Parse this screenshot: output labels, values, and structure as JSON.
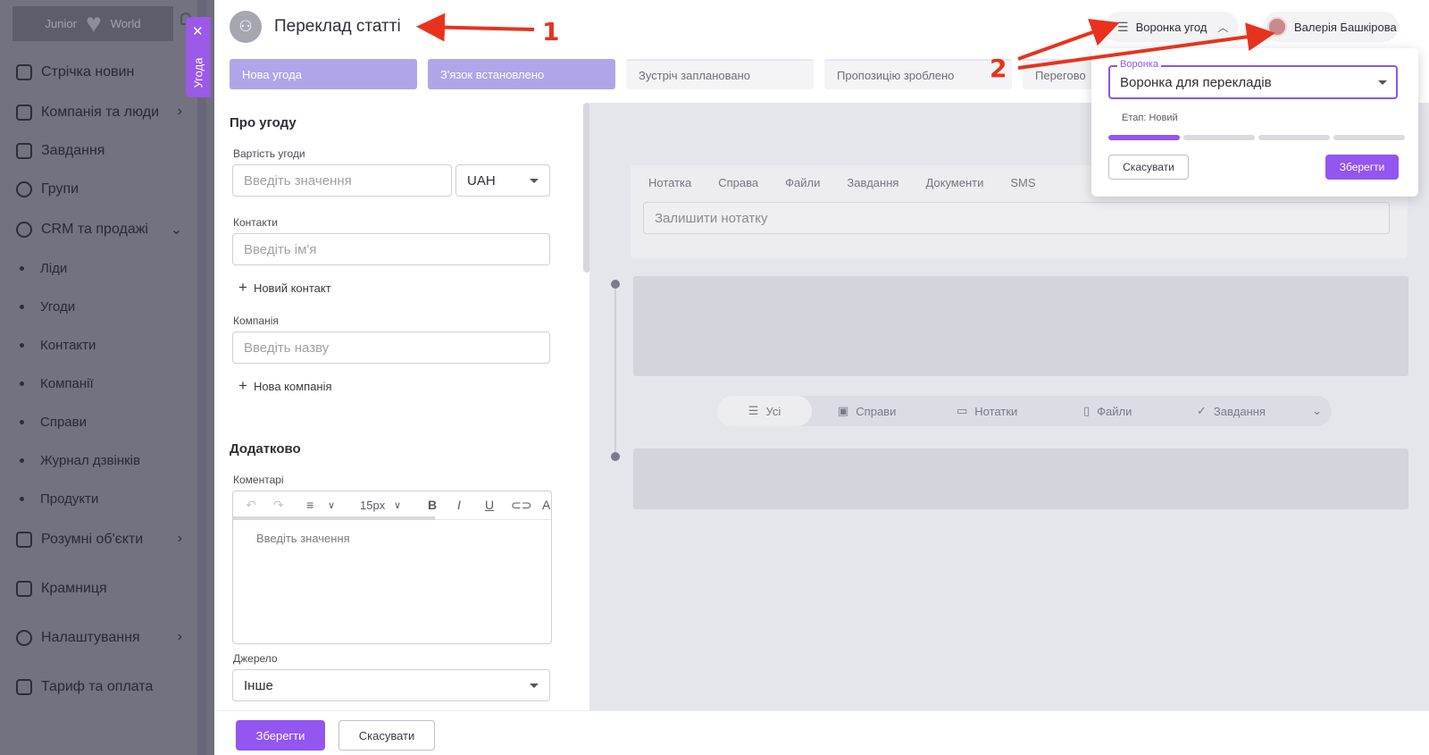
{
  "sidebar": {
    "logo_left": "Junior",
    "logo_right": "World",
    "items": [
      {
        "label": "Стрічка новин"
      },
      {
        "label": "Компанія та люди"
      },
      {
        "label": "Завдання"
      },
      {
        "label": "Групи"
      },
      {
        "label": "CRM та продажі"
      },
      {
        "label": "Розумні об'єкти"
      },
      {
        "label": "Крамниця"
      },
      {
        "label": "Налаштування"
      },
      {
        "label": "Тариф та оплата"
      }
    ],
    "subitems": [
      {
        "label": "Ліди"
      },
      {
        "label": "Угоди"
      },
      {
        "label": "Контакти"
      },
      {
        "label": "Компанії"
      },
      {
        "label": "Справи"
      },
      {
        "label": "Журнал дзвінків"
      },
      {
        "label": "Продукти"
      }
    ]
  },
  "drawer_tab": {
    "label": "Угода",
    "close": "✕"
  },
  "header": {
    "title": "Переклад статті",
    "funnel_button": "Воронка угод",
    "user_name": "Валерія Башкірова"
  },
  "stages": [
    {
      "label": "Нова угода"
    },
    {
      "label": "З'язок встановлено"
    },
    {
      "label": "Зустріч заплановано"
    },
    {
      "label": "Пропозицію зроблено"
    },
    {
      "label": "Перегово"
    }
  ],
  "form": {
    "about_title": "Про угоду",
    "value_label": "Вартість угоди",
    "value_placeholder": "Введіть значення",
    "currency": "UAH",
    "contacts_label": "Контакти",
    "contacts_placeholder": "Введіть ім'я",
    "new_contact": "Новий контакт",
    "company_label": "Компанія",
    "company_placeholder": "Введіть назву",
    "new_company": "Нова компанія",
    "extra_title": "Додатково",
    "comments_label": "Коментарі",
    "font_size": "15px",
    "editor_placeholder": "Введіть значення",
    "source_label": "Джерело",
    "source_value": "Інше"
  },
  "activity": {
    "tabs": [
      "Нотатка",
      "Справа",
      "Файли",
      "Завдання",
      "Документи",
      "SMS"
    ],
    "note_placeholder": "Залишити нотатку",
    "filters": [
      "Усі",
      "Справи",
      "Нотатки",
      "Файли",
      "Завдання"
    ]
  },
  "bottom": {
    "save": "Зберегти",
    "cancel": "Скасувати"
  },
  "popover": {
    "legend": "Воронка",
    "funnel_value": "Воронка для перекладів",
    "stage_text": "Етап: Новий",
    "cancel": "Скасувати",
    "save": "Зберегти",
    "progress_active_steps": 1,
    "progress_total_steps": 4
  },
  "annotations": {
    "one": "1",
    "two": "2"
  },
  "colors": {
    "accent": "#9356f0",
    "stage_active": "#b0a5e8",
    "annotation": "#e8321e"
  }
}
